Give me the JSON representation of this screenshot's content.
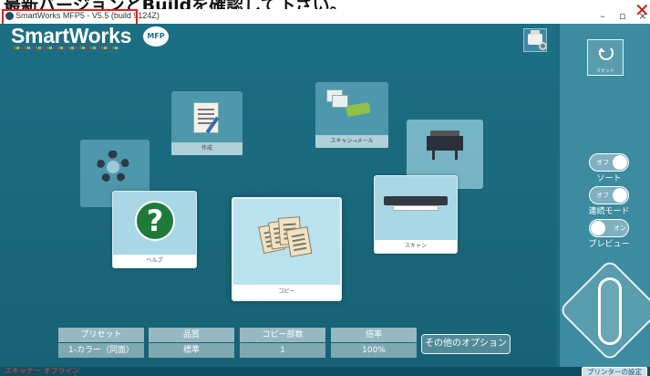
{
  "banner": {
    "text": "最新バージョンとBuildを確認して下さい。"
  },
  "window": {
    "title": "SmartWorks MFP5 - V5.5 (build 9124Z)",
    "minimize": "–",
    "maximize": "▫",
    "close": "×"
  },
  "header": {
    "logo": "SmartWorks",
    "logo_badge": "MFP"
  },
  "tiles": {
    "settings": {
      "label": ""
    },
    "edit": {
      "label": "作成"
    },
    "scan_to_email": {
      "label": "スキャン→メール"
    },
    "print": {
      "label": ""
    },
    "help": {
      "label": "ヘルプ"
    },
    "copy": {
      "label": "コピー"
    },
    "scan": {
      "label": "スキャン"
    }
  },
  "options": [
    {
      "label": "プリセット",
      "value": "1-カラー（同面）"
    },
    {
      "label": "品質",
      "value": "標準"
    },
    {
      "label": "コピー部数",
      "value": "1"
    },
    {
      "label": "倍率",
      "value": "100%"
    }
  ],
  "more_options": "その他のオプション",
  "side": {
    "close": "✕",
    "reset_label": "リセット",
    "sort": {
      "state": "オフ",
      "caption": "ソート"
    },
    "continuous": {
      "state": "オフ",
      "caption": "連続モード"
    },
    "preview": {
      "state": "オン",
      "caption": "プレビュー"
    }
  },
  "status": {
    "scanner": "スキャナー オフライン",
    "printer_settings": "プリンターの設定"
  },
  "colors": {
    "background": "#1c6c80",
    "side_panel": "#3c8ba0",
    "highlight_box": "#e02020",
    "status_error": "#ff3a3a"
  },
  "icons": [
    "gear-icon",
    "edit-document-icon",
    "scan-to-email-icon",
    "plotter-icon",
    "help-icon",
    "copy-icon",
    "scanner-icon",
    "reset-icon",
    "start-icon",
    "printer-settings-icon"
  ]
}
